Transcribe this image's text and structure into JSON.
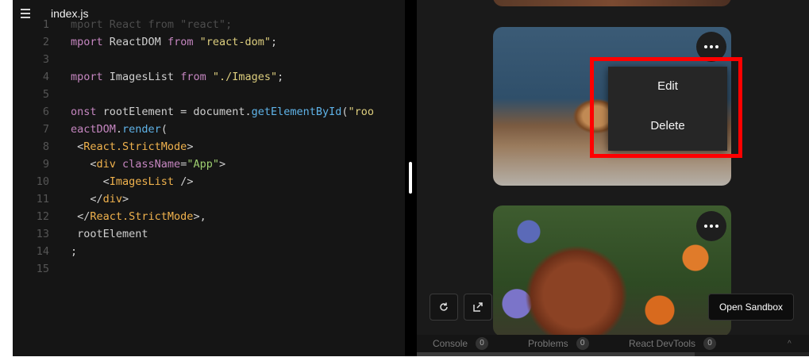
{
  "editor": {
    "file_name": "index.js",
    "lines": [
      {
        "n": "1",
        "parts": [
          [
            "cm",
            "mport React from \"react\";"
          ]
        ]
      },
      {
        "n": "2",
        "parts": [
          [
            "kw",
            "mport "
          ],
          [
            "pl",
            "ReactDOM "
          ],
          [
            "kw",
            "from "
          ],
          [
            "st",
            "\"react-dom\""
          ],
          [
            "pl",
            ";"
          ]
        ]
      },
      {
        "n": "3",
        "parts": []
      },
      {
        "n": "4",
        "parts": [
          [
            "kw",
            "mport "
          ],
          [
            "pl",
            "ImagesList "
          ],
          [
            "kw",
            "from "
          ],
          [
            "st",
            "\"./Images\""
          ],
          [
            "pl",
            ";"
          ]
        ]
      },
      {
        "n": "5",
        "parts": []
      },
      {
        "n": "6",
        "parts": [
          [
            "kw",
            "onst "
          ],
          [
            "pl",
            "rootElement = document."
          ],
          [
            "fn",
            "getElementById"
          ],
          [
            "pl",
            "("
          ],
          [
            "st",
            "\"roo"
          ]
        ]
      },
      {
        "n": "7",
        "parts": [
          [
            "kw",
            "eactDOM"
          ],
          [
            "pl",
            "."
          ],
          [
            "fn",
            "render"
          ],
          [
            "pl",
            "("
          ]
        ]
      },
      {
        "n": "8",
        "parts": [
          [
            "pl",
            " <"
          ],
          [
            "tg",
            "React.StrictMode"
          ],
          [
            "pl",
            ">"
          ]
        ]
      },
      {
        "n": "9",
        "parts": [
          [
            "pl",
            "   <"
          ],
          [
            "tg",
            "div "
          ],
          [
            "at",
            "className"
          ],
          [
            "pl",
            "="
          ],
          [
            "sv",
            "\"App\""
          ],
          [
            "pl",
            ">"
          ]
        ]
      },
      {
        "n": "10",
        "parts": [
          [
            "pl",
            "     <"
          ],
          [
            "tg",
            "ImagesList "
          ],
          [
            "pl",
            "/>"
          ]
        ]
      },
      {
        "n": "11",
        "parts": [
          [
            "pl",
            "   </"
          ],
          [
            "tg",
            "div"
          ],
          [
            "pl",
            ">"
          ]
        ]
      },
      {
        "n": "12",
        "parts": [
          [
            "pl",
            " </"
          ],
          [
            "tg",
            "React.StrictMode"
          ],
          [
            "pl",
            ">,"
          ]
        ]
      },
      {
        "n": "13",
        "parts": [
          [
            "pl",
            " rootElement"
          ]
        ]
      },
      {
        "n": "14",
        "parts": [
          [
            "pl",
            ";"
          ]
        ]
      },
      {
        "n": "15",
        "parts": []
      }
    ]
  },
  "preview": {
    "menu": {
      "edit_label": "Edit",
      "delete_label": "Delete"
    },
    "open_sandbox_label": "Open Sandbox"
  },
  "devtools": {
    "tabs": [
      {
        "label": "Console",
        "count": "0"
      },
      {
        "label": "Problems",
        "count": "0"
      },
      {
        "label": "React DevTools",
        "count": "0"
      }
    ]
  },
  "colors": {
    "highlight": "#ff0000",
    "editor_bg": "#151515",
    "preview_bg": "#1a1a1a"
  }
}
